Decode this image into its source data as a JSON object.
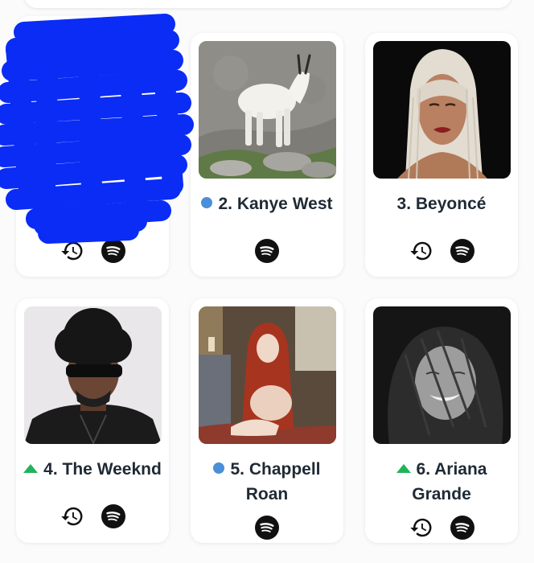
{
  "colors": {
    "dot_new": "#4a8fd8",
    "up_arrow": "#22b35a",
    "text": "#1f2a35",
    "spotify_circle": "#111111"
  },
  "artists": [
    {
      "rank_label": "",
      "indicator": "none",
      "icons": [
        "history-icon",
        "spotify-icon"
      ]
    },
    {
      "rank_label": "2. Kanye West",
      "indicator": "new-dot",
      "icons": [
        "spotify-icon"
      ]
    },
    {
      "rank_label": "3. Beyoncé",
      "indicator": "none",
      "icons": [
        "history-icon",
        "spotify-icon"
      ]
    },
    {
      "rank_label": "4. The Weeknd",
      "indicator": "up-arrow",
      "icons": [
        "history-icon",
        "spotify-icon"
      ]
    },
    {
      "rank_label": "5. Chappell Roan",
      "indicator": "new-dot",
      "icons": [
        "spotify-icon"
      ]
    },
    {
      "rank_label": "6. Ariana Grande",
      "indicator": "up-arrow",
      "icons": [
        "history-icon",
        "spotify-icon"
      ]
    }
  ]
}
